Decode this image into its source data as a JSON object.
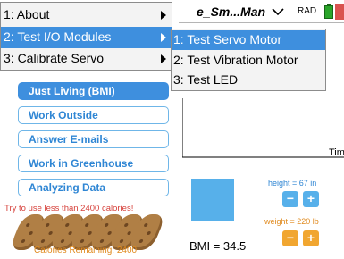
{
  "header": {
    "doc_title": "e_Sm...Man",
    "angle_mode": "RAD"
  },
  "main_menu": {
    "items": [
      {
        "label": "1: About"
      },
      {
        "label": "2: Test I/O Modules"
      },
      {
        "label": "3: Calibrate Servo"
      }
    ]
  },
  "sub_menu": {
    "items": [
      {
        "label": "1: Test Servo Motor"
      },
      {
        "label": "2: Test Vibration Motor"
      },
      {
        "label": "3: Test LED"
      }
    ]
  },
  "activities": {
    "items": [
      {
        "label": "Just Living (BMI)"
      },
      {
        "label": "Work Outside"
      },
      {
        "label": "Answer E-mails"
      },
      {
        "label": "Work in Greenhouse"
      },
      {
        "label": "Analyzing Data"
      }
    ]
  },
  "calorie_hint": "Try to use less than 2400 calories!",
  "calories_remaining": "Calories Remaining:  2400",
  "cookie_count": 7,
  "graph": {
    "axis_label": "Tim"
  },
  "bmi": {
    "readout": "BMI = 34.5"
  },
  "height": {
    "label": "height = 67 in",
    "minus": "−",
    "plus": "+"
  },
  "weight": {
    "label": "weight = 220 lb",
    "minus": "−",
    "plus": "+"
  },
  "colors": {
    "accent_blue": "#3e8fde",
    "text_blue": "#2f86d4",
    "orange": "#f1a630",
    "warning_red": "#d6403a",
    "cookie_brown": "#b07f45"
  }
}
